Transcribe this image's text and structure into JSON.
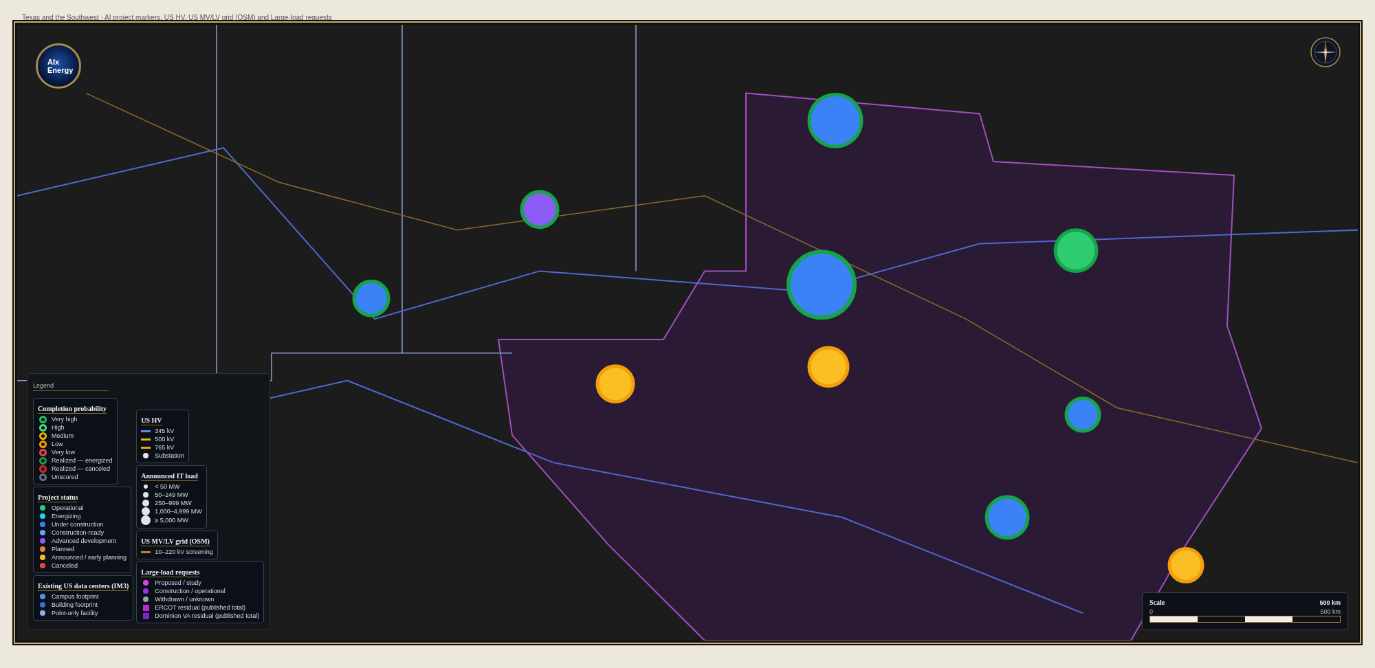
{
  "title": "Texas and the Southwest · AI project markers, US HV, US MV/LV grid (OSM) and Large-load requests",
  "logo": {
    "lines": [
      "AIx",
      "Energy"
    ]
  },
  "legend": {
    "title": "Legend",
    "columns": [
      {
        "sections": [
          {
            "title": "Completion probability",
            "items": [
              {
                "label": "Very high",
                "kind": "ring",
                "color": "#22c55e"
              },
              {
                "label": "High",
                "kind": "ring",
                "color": "#4ade80"
              },
              {
                "label": "Medium",
                "kind": "ring",
                "color": "#eab308"
              },
              {
                "label": "Low",
                "kind": "ring",
                "color": "#f59e0b"
              },
              {
                "label": "Very low",
                "kind": "ring",
                "color": "#ef4444"
              },
              {
                "label": "Realized — energized",
                "kind": "ring",
                "color": "#16a34a"
              },
              {
                "label": "Realized — canceled",
                "kind": "ring",
                "color": "#dc2626"
              },
              {
                "label": "Unscored",
                "kind": "ring",
                "color": "#64748b"
              }
            ]
          },
          {
            "title": "Project status",
            "items": [
              {
                "label": "Operational",
                "kind": "dot",
                "color": "#2ecc71"
              },
              {
                "label": "Energizing",
                "kind": "dot",
                "color": "#22d3ee"
              },
              {
                "label": "Under construction",
                "kind": "dot",
                "color": "#3b82f6"
              },
              {
                "label": "Construction-ready",
                "kind": "dot",
                "color": "#60a5fa"
              },
              {
                "label": "Advanced development",
                "kind": "dot",
                "color": "#8b5cf6"
              },
              {
                "label": "Planned",
                "kind": "dot",
                "color": "#e08a2e"
              },
              {
                "label": "Announced / early planning",
                "kind": "dot",
                "color": "#fbbf24"
              },
              {
                "label": "Canceled",
                "kind": "dot",
                "color": "#ef4444"
              }
            ]
          },
          {
            "title": "Existing US data centers (IM3)",
            "items": [
              {
                "label": "Campus footprint",
                "kind": "dot",
                "color": "#5b8def"
              },
              {
                "label": "Building footprint",
                "kind": "dot",
                "color": "#3b6fd8"
              },
              {
                "label": "Point-only facility",
                "kind": "dot",
                "color": "#8fb0f0"
              }
            ]
          }
        ]
      },
      {
        "sections": [
          {
            "title": "US HV",
            "items": [
              {
                "label": "345 kV",
                "kind": "line",
                "color": "#5b8def"
              },
              {
                "label": "500 kV",
                "kind": "line",
                "color": "#eab308"
              },
              {
                "label": "765 kV",
                "kind": "line",
                "color": "#f59e0b"
              },
              {
                "label": "Substation",
                "kind": "dot",
                "color": "#e5e7eb"
              }
            ]
          },
          {
            "title": "Announced IT load",
            "items": [
              {
                "label": "< 50 MW",
                "kind": "size",
                "color": "#dbe4f0"
              },
              {
                "label": "50–249 MW",
                "kind": "size",
                "color": "#dbe4f0"
              },
              {
                "label": "250–999 MW",
                "kind": "size",
                "color": "#dbe4f0"
              },
              {
                "label": "1,000–4,999 MW",
                "kind": "size",
                "color": "#dbe4f0"
              },
              {
                "label": "≥ 5,000 MW",
                "kind": "size",
                "color": "#dbe4f0"
              }
            ]
          },
          {
            "title": "US MV/LV grid (OSM)",
            "items": [
              {
                "label": "10–220 kV screening",
                "kind": "line",
                "color": "#b8862b"
              }
            ]
          },
          {
            "title": "Large-load requests",
            "items": [
              {
                "label": "Proposed / study",
                "kind": "dot",
                "color": "#d946ef"
              },
              {
                "label": "Construction / operational",
                "kind": "dot",
                "color": "#9333ea"
              },
              {
                "label": "Withdrawn / unknown",
                "kind": "dot",
                "color": "#9ca3af"
              },
              {
                "label": "ERCOT residual (published total)",
                "kind": "square",
                "color": "#c026d3"
              },
              {
                "label": "Dominion VA residual (published total)",
                "kind": "square",
                "color": "#7e22ce"
              }
            ]
          }
        ]
      }
    ]
  },
  "scale": {
    "title": "Scale",
    "reading": "500 km",
    "start": "0",
    "end": "500 km"
  }
}
